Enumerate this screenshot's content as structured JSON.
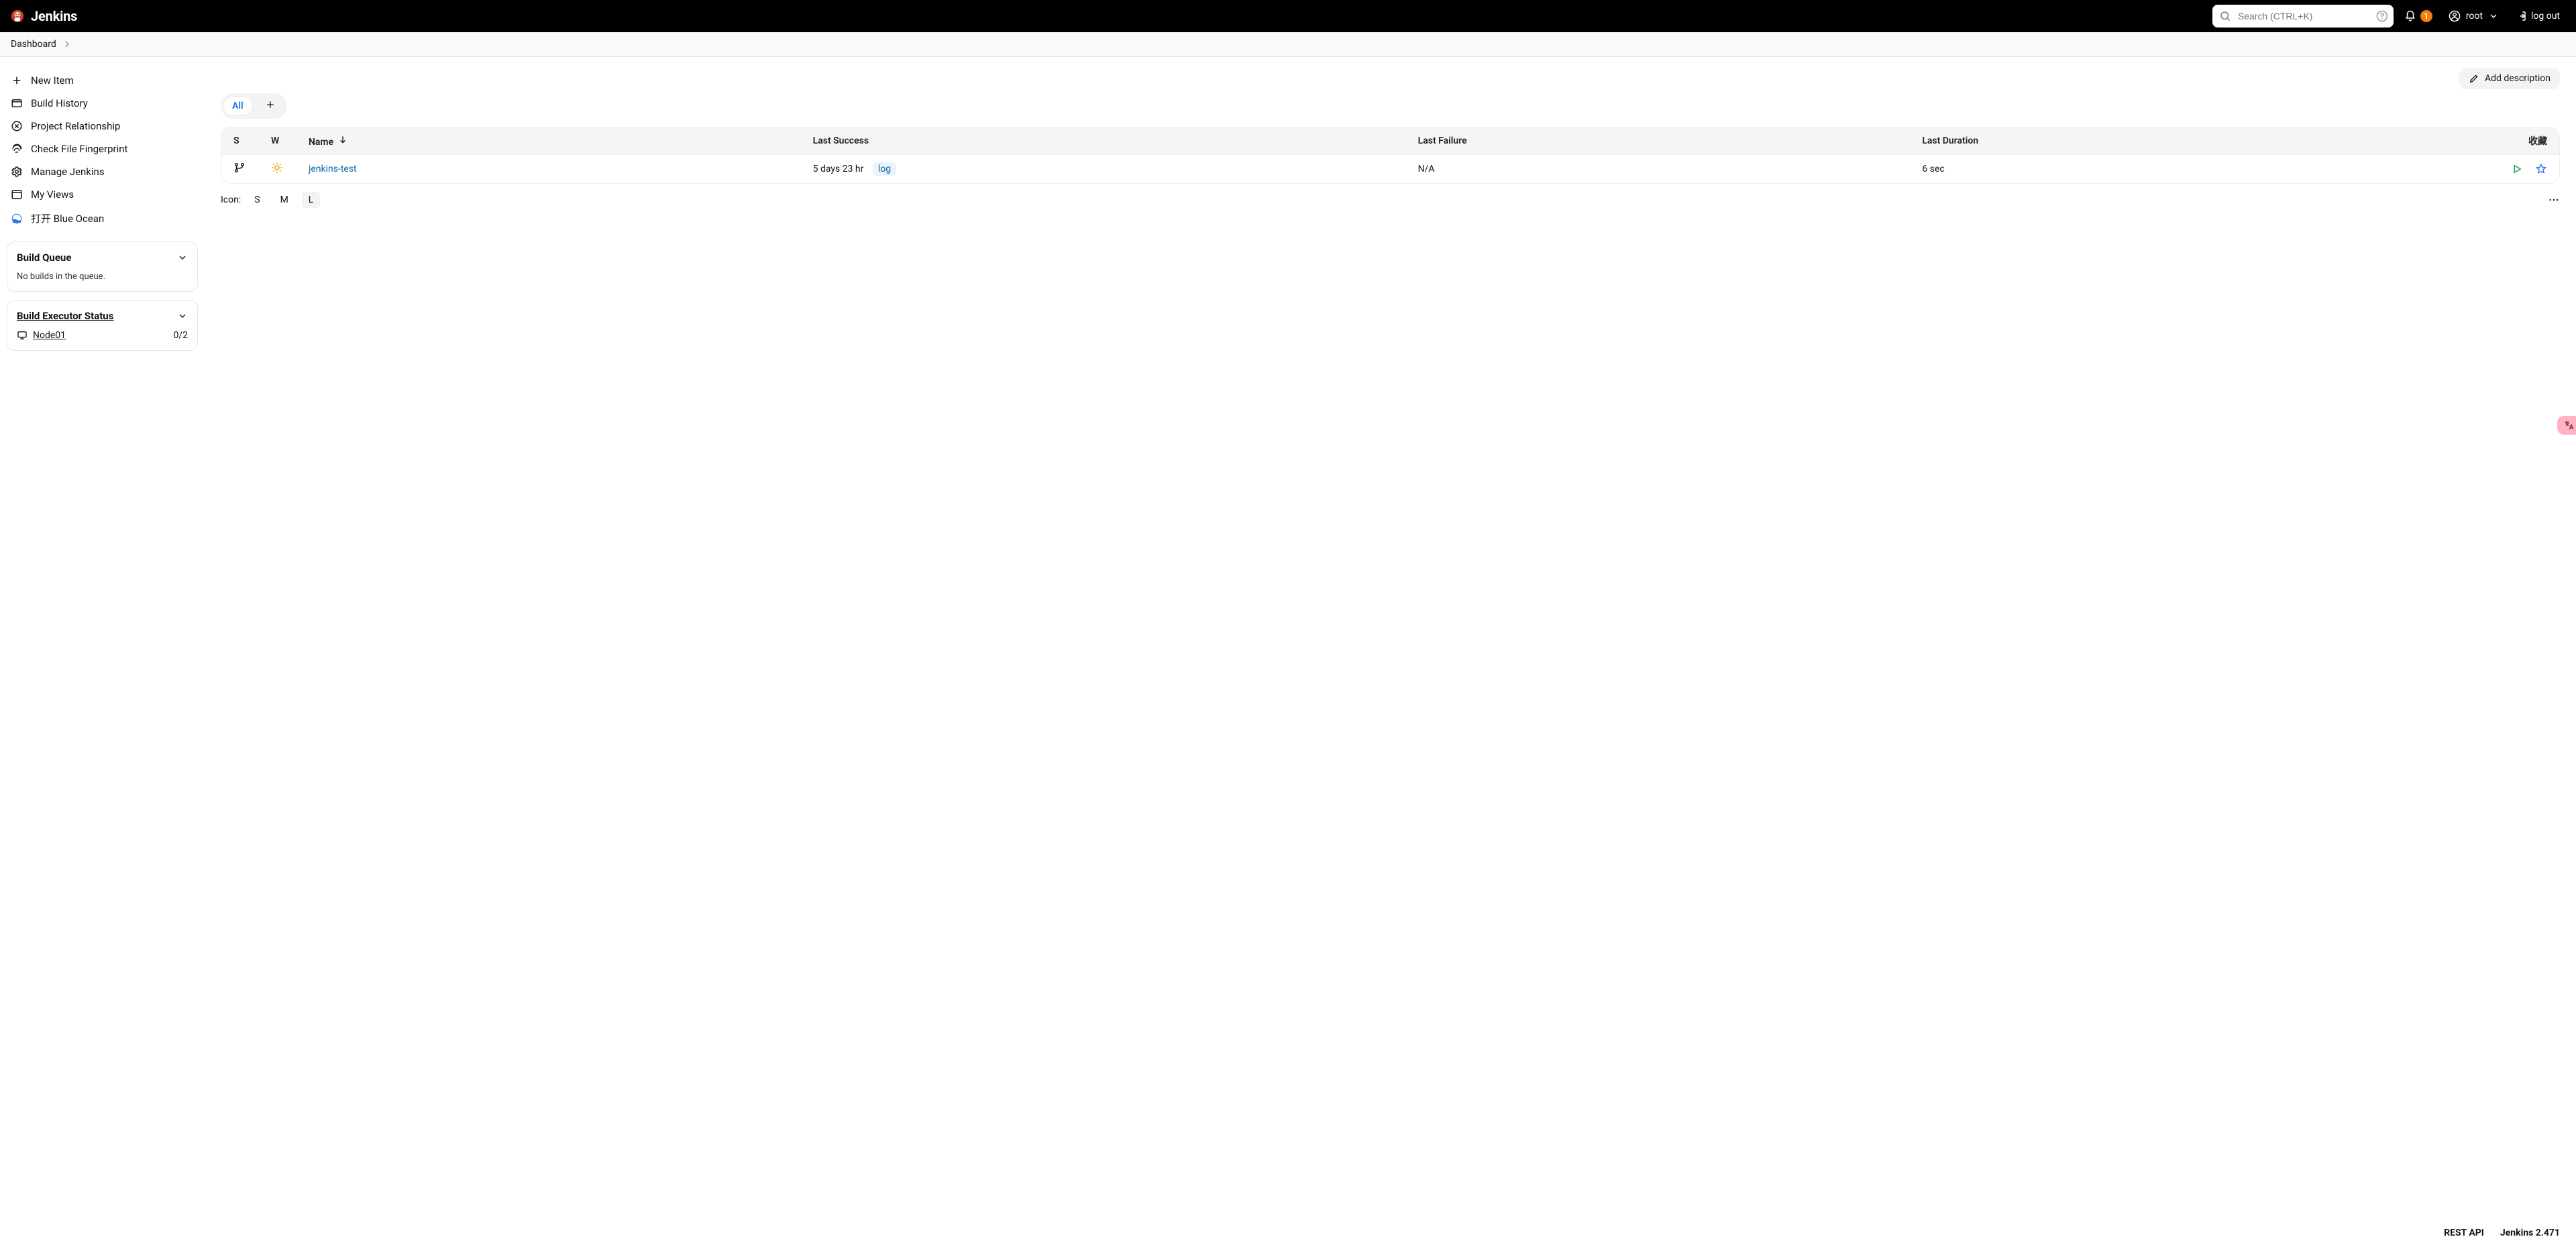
{
  "brand": {
    "name": "Jenkins"
  },
  "header": {
    "search_placeholder": "Search (CTRL+K)",
    "notifications_count": "1",
    "username": "root",
    "logout_label": "log out"
  },
  "breadcrumb": {
    "dashboard": "Dashboard"
  },
  "sidebar": {
    "items": [
      {
        "id": "new-item",
        "label": "New Item"
      },
      {
        "id": "build-history",
        "label": "Build History"
      },
      {
        "id": "project-relationship",
        "label": "Project Relationship"
      },
      {
        "id": "check-fingerprint",
        "label": "Check File Fingerprint"
      },
      {
        "id": "manage-jenkins",
        "label": "Manage Jenkins"
      },
      {
        "id": "my-views",
        "label": "My Views"
      },
      {
        "id": "blue-ocean",
        "label": "打开 Blue Ocean"
      }
    ],
    "build_queue": {
      "title": "Build Queue",
      "empty_text": "No builds in the queue."
    },
    "executor": {
      "title": "Build Executor Status",
      "node_name": "Node01",
      "node_usage": "0/2"
    }
  },
  "actions": {
    "add_description": "Add description"
  },
  "tabs": {
    "all": "All"
  },
  "table": {
    "headers": {
      "s": "S",
      "w": "W",
      "name": "Name",
      "last_success": "Last Success",
      "last_failure": "Last Failure",
      "last_duration": "Last Duration",
      "favorite": "收藏"
    },
    "rows": [
      {
        "name": "jenkins-test",
        "last_success": "5 days 23 hr",
        "log_label": "log",
        "last_failure": "N/A",
        "last_duration": "6 sec"
      }
    ]
  },
  "icon_size": {
    "label": "Icon:",
    "s": "S",
    "m": "M",
    "l": "L",
    "active": "L"
  },
  "footer": {
    "rest_api": "REST API",
    "version": "Jenkins 2.471"
  }
}
